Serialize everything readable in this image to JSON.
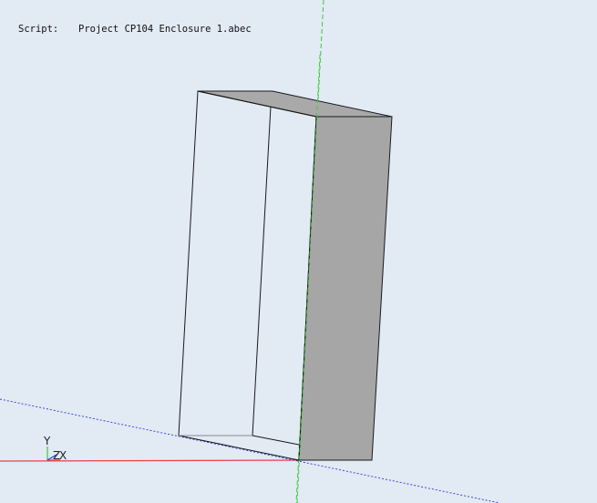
{
  "script": {
    "label": "Script:",
    "filename": "Project CP104 Enclosure 1.abec"
  },
  "axes": {
    "y_label": "Y",
    "z_label": "Z",
    "x_label": "X"
  },
  "colors": {
    "background": "#e2eaf4",
    "x_axis": "#e8404a",
    "y_axis": "#3ac83a",
    "z_axis": "#2a3ad8",
    "solid_face": "#a6a6a6",
    "edge": "#1a1a1a"
  }
}
